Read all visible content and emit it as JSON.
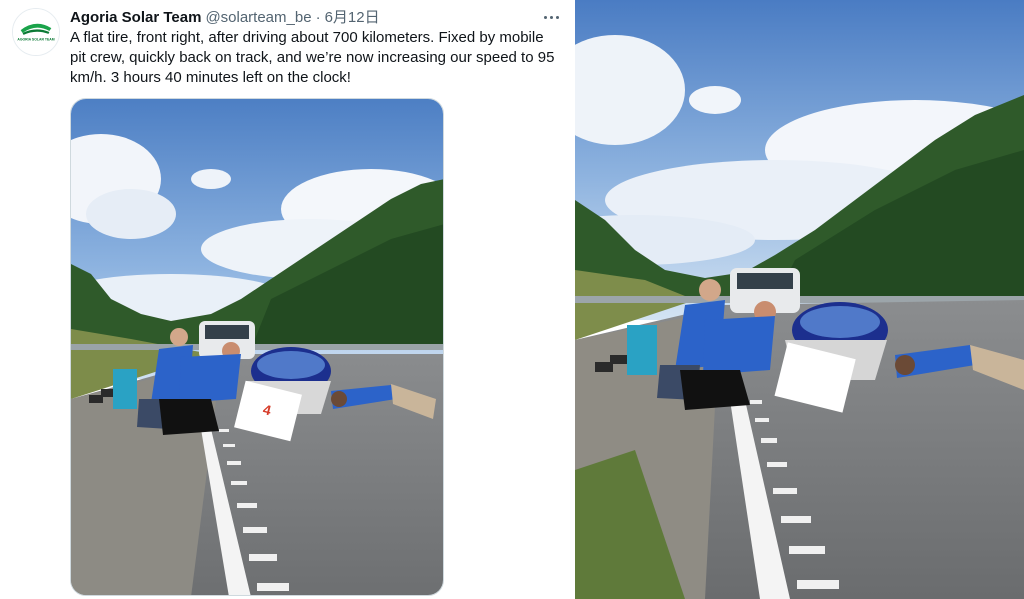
{
  "tweet": {
    "author_name": "Agoria Solar Team",
    "handle": "@solarteam_be",
    "separator": "·",
    "date": "6月12日",
    "text": "A flat tire, front right, after driving about 700 kilometers. Fixed by mobile pit crew, quickly back on track, and we’re now increasing our speed to 95 km/h. 3 hours 40 minutes left on the clock!",
    "avatar_icon": "agoria-solar-team-logo",
    "more_icon": "more-horizontal-icon",
    "avatar_logo_text": "AGORIA SOLAR TEAM"
  },
  "media": {
    "description_icon": "photo",
    "car_sign_number": "4"
  },
  "colors": {
    "text_primary": "#0f1419",
    "text_secondary": "#536471",
    "brand_green": "#1aa34a",
    "vest_blue": "#2c63c9",
    "car_canopy_blue": "#1c2f8e"
  }
}
